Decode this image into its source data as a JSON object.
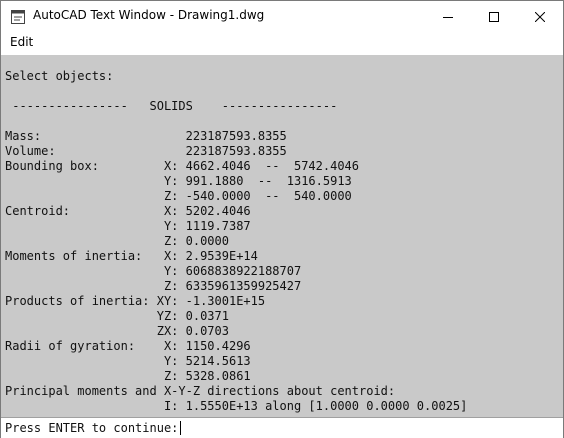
{
  "window": {
    "title": "AutoCAD Text Window - Drawing1.dwg"
  },
  "menu": {
    "items": [
      "Edit"
    ]
  },
  "output": {
    "lines": [
      "Select objects:",
      " ----------------   SOLIDS    ----------------",
      "Mass:                    223187593.8355",
      "Volume:                  223187593.8355",
      "Bounding box:         X: 4662.4046  --  5742.4046",
      "                      Y: 991.1880  --  1316.5913",
      "                      Z: -540.0000  --  540.0000",
      "Centroid:             X: 5202.4046",
      "                      Y: 1119.7387",
      "                      Z: 0.0000",
      "Moments of inertia:   X: 2.9539E+14",
      "                      Y: 6068838922188707",
      "                      Z: 6335961359925427",
      "Products of inertia: XY: -1.3001E+15",
      "                     YZ: 0.0371",
      "                     ZX: 0.0703",
      "Radii of gyration:    X: 1150.4296",
      "                      Y: 5214.5613",
      "                      Z: 5328.0861",
      "Principal moments and X-Y-Z directions about centroid:",
      "                      I: 1.5550E+13 along [1.0000 0.0000 0.0025]"
    ]
  },
  "command": {
    "prompt": "Press ENTER to continue:"
  },
  "colors": {
    "output_background": "#c9c9c9",
    "text": "#111111"
  },
  "icons": {
    "app": "autocad-window-icon",
    "minimize": "minimize-icon",
    "maximize": "maximize-icon",
    "close": "close-icon"
  }
}
